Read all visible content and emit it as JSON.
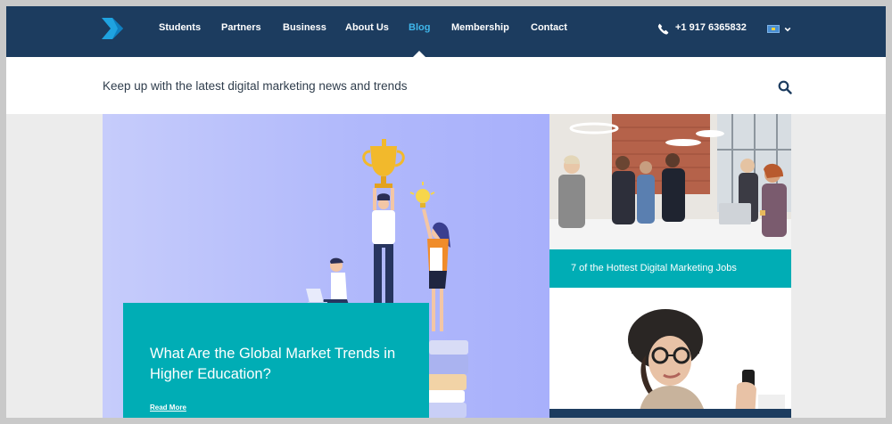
{
  "nav": {
    "items": [
      {
        "label": "Students",
        "active": false
      },
      {
        "label": "Partners",
        "active": false
      },
      {
        "label": "Business",
        "active": false
      },
      {
        "label": "About Us",
        "active": false
      },
      {
        "label": "Blog",
        "active": true
      },
      {
        "label": "Membership",
        "active": false
      },
      {
        "label": "Contact",
        "active": false
      }
    ],
    "phone": "+1 917 6365832",
    "language_flag_icon": "flag-icon",
    "colors": {
      "bar": "#1c3c5f",
      "active": "#3fb6ea",
      "logo": "#1fa3e0"
    }
  },
  "tagbar": {
    "tagline": "Keep up with the latest digital marketing news and trends",
    "search_icon": "search-icon"
  },
  "hero": {
    "title": "What Are the Global Market Trends in Higher Education?",
    "read_more": "Read More",
    "card_color": "#00adb5"
  },
  "side_cards": [
    {
      "title": "7 of the Hottest Digital Marketing Jobs",
      "band_color": "#00adb5"
    },
    {
      "title": "",
      "band_color": "#1c3c5f"
    }
  ]
}
